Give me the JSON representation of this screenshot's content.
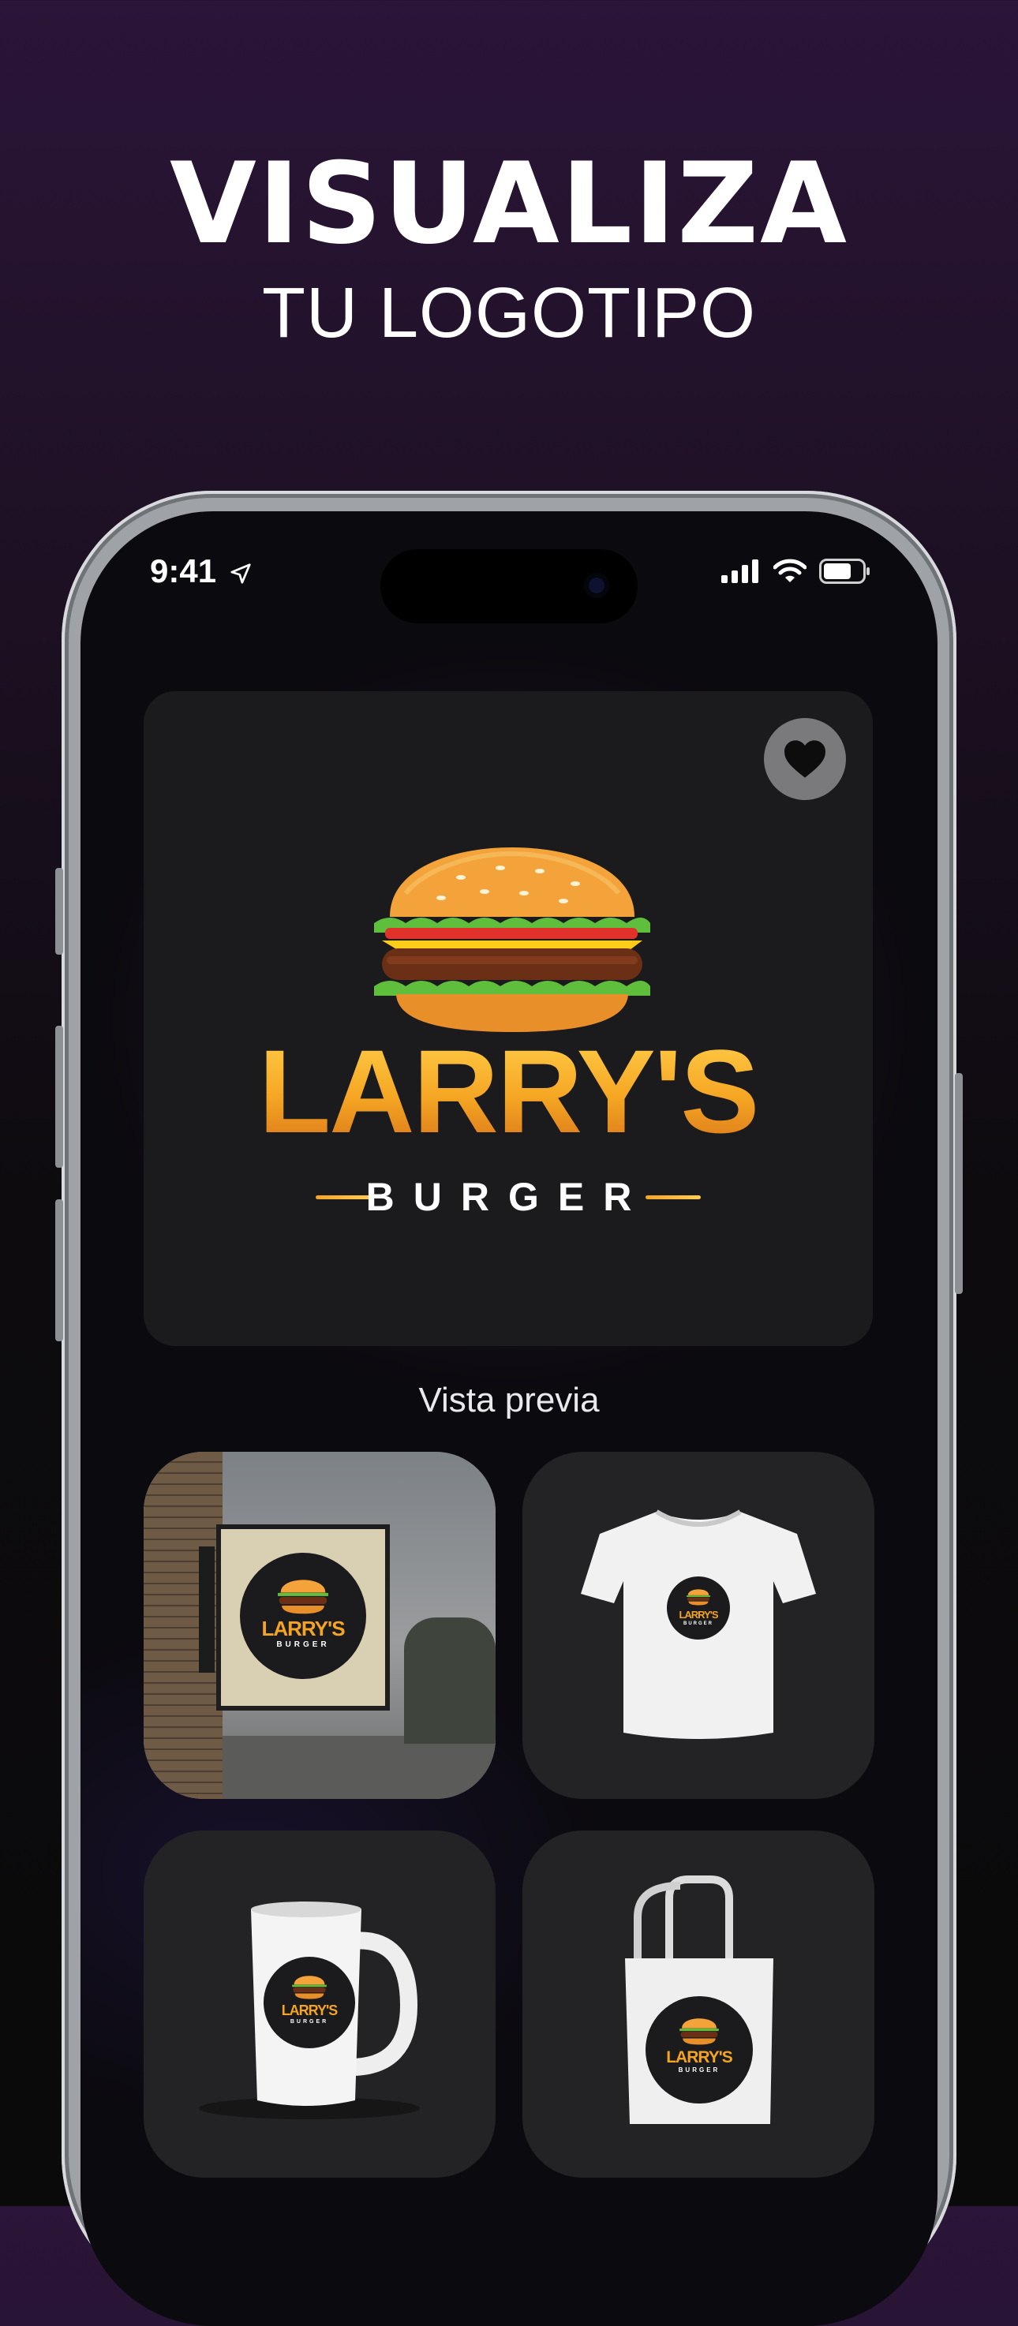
{
  "headline": {
    "title": "VISUALIZA",
    "subtitle": "TU LOGOTIPO"
  },
  "status_bar": {
    "time": "9:41"
  },
  "logo": {
    "name": "LARRY'S",
    "tagline": "BURGER"
  },
  "preview": {
    "label": "Vista previa",
    "items": [
      {
        "id": "sign",
        "label": ""
      },
      {
        "id": "tshirt",
        "label": ""
      },
      {
        "id": "mug",
        "label": ""
      },
      {
        "id": "tote",
        "label": ""
      }
    ],
    "mini_name": "LARRY'S",
    "mini_sub": "BURGER"
  },
  "colors": {
    "accent": "#f5a623",
    "card": "#1b1b1d",
    "tile": "#232325",
    "favorite_bg": "#7a7a7c"
  },
  "icons": [
    "location-arrow-icon",
    "signal-icon",
    "wifi-icon",
    "battery-icon",
    "heart-icon"
  ]
}
